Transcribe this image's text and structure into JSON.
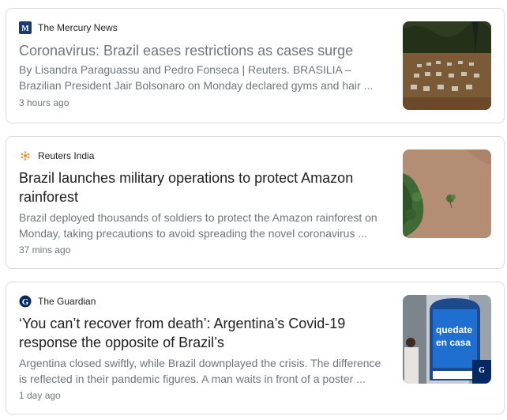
{
  "articles": [
    {
      "source": "The Mercury News",
      "favicon": "mercury-news-icon",
      "headline": "Coronavirus: Brazil eases restrictions as cases surge",
      "snippet": "By Lisandra Paraguassu and Pedro Fonseca | Reuters. BRASILIA – Brazilian President Jair Bolsonaro on Monday declared gyms and hair ...",
      "time": "3 hours ago",
      "thumbnail": "cemetery-graves-image"
    },
    {
      "source": "Reuters India",
      "favicon": "reuters-icon",
      "headline": "Brazil launches military operations to protect Amazon rainforest",
      "snippet": "Brazil deployed thousands of soldiers to protect the Amazon rainforest on Monday, taking precautions to avoid spreading the novel coronavirus ...",
      "time": "37 mins ago",
      "thumbnail": "amazon-aerial-image"
    },
    {
      "source": "The Guardian",
      "favicon": "guardian-icon",
      "headline": "‘You can’t recover from death’: Argentina’s Covid-19 response the opposite of Brazil’s",
      "snippet": "Argentina closed swiftly, while Brazil downplayed the crisis. The difference is reflected in their pandemic figures. A man waits in front of a poster ...",
      "time": "1 day ago",
      "thumbnail": "quedate-en-casa-poster-image",
      "thumbnail_text_1": "quedate",
      "thumbnail_text_2": "en casa"
    }
  ]
}
